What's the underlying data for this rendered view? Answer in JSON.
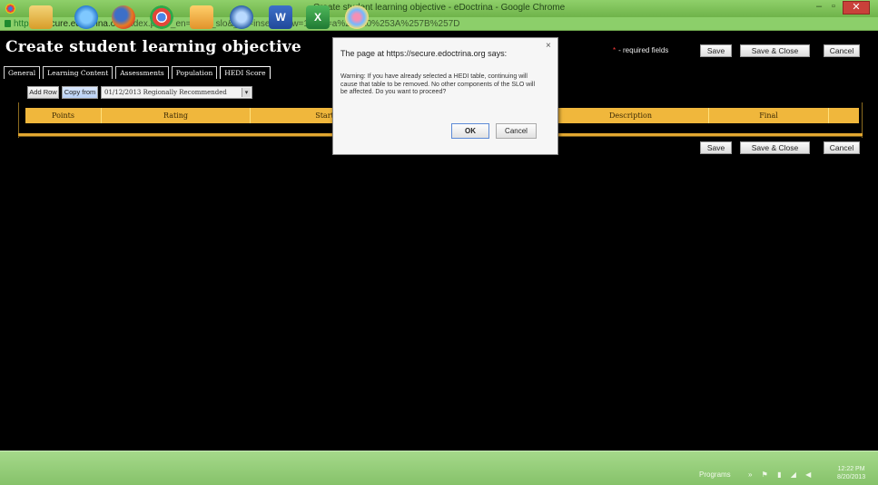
{
  "window": {
    "title": "Create student learning objective - eDoctrina - Google Chrome",
    "minimize": "–",
    "restore": "▫",
    "close": "✕"
  },
  "address": {
    "scheme": "https://",
    "host": "secure.edoctrina.org",
    "path": "/index.php?_en=edoc_slo&_ac=insert&_pw=1&_ip=a%253A0%253A%257B%257D"
  },
  "page": {
    "title": "Create student learning objective",
    "required_note": "- required fields",
    "required_star": "*",
    "save": "Save",
    "save_close": "Save & Close",
    "cancel": "Cancel"
  },
  "tabs": [
    "General",
    "Learning Content",
    "Assessments",
    "Population",
    "HEDI Score"
  ],
  "toolbar": {
    "add_row": "Add Row",
    "copy_from": "Copy from",
    "copy_select_value": "01/12/2013 Regionally Recommended"
  },
  "table": {
    "columns": [
      "Points",
      "Rating",
      "Start",
      "",
      "Description",
      "Final",
      ""
    ]
  },
  "dialog": {
    "title": "The page at https://secure.edoctrina.org says:",
    "close": "×",
    "message": "Warning: If you have already selected a HEDI table, continuing will cause that table to be removed. No other components of the SLO will be affected. Do you want to proceed?",
    "ok": "OK",
    "cancel": "Cancel"
  },
  "taskbar": {
    "programs": "Programs",
    "tray_icons": "» ⚑ ▮ ◢ ◀",
    "time": "12:22 PM",
    "date": "8/20/2013",
    "word_glyph": "W",
    "excel_glyph": "X"
  }
}
